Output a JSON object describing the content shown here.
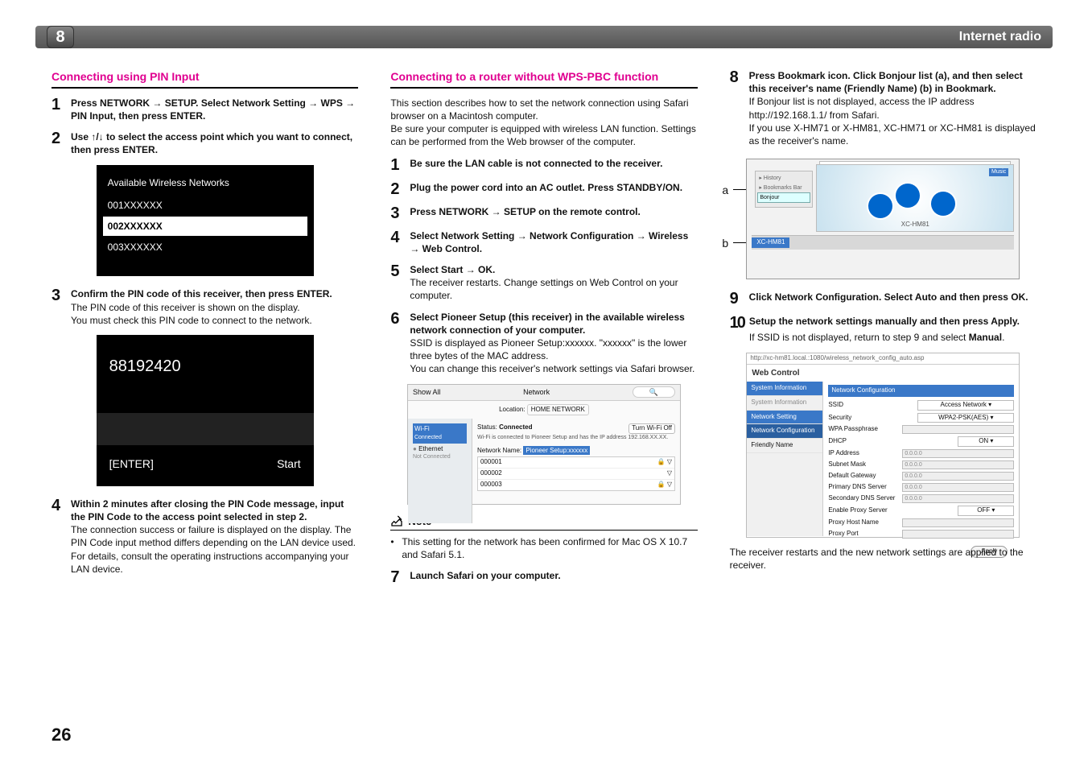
{
  "page": {
    "chapter_badge": "8",
    "section_title": "Internet radio",
    "footer_page": "26"
  },
  "col1": {
    "heading": "Connecting using PIN Input",
    "step1": "Press NETWORK → SETUP. Select Network Setting → WPS → PIN Input, then press ENTER.",
    "step2": "Use ↑/↓ to select the access point which you want to connect, then press ENTER.",
    "wifi_title": "Available Wireless Networks",
    "wifi_items": [
      "001XXXXXX",
      "002XXXXXX",
      "003XXXXXX"
    ],
    "step3_strong": "Confirm the PIN code of this receiver, then press ENTER.",
    "step3_body1": "The PIN code of this receiver is shown on the display.",
    "step3_body2": "You must check this PIN code to connect to the network.",
    "pin_code": "88192420",
    "pin_enter": "[ENTER]",
    "pin_start": "Start",
    "step4_strong": "Within 2 minutes after closing the PIN Code message, input the PIN Code to the access point selected in step 2.",
    "step4_body": "The connection success or failure is displayed on the display. The PIN Code input method differs depending on the LAN device used. For details, consult the operating instructions accompanying your LAN device."
  },
  "col2": {
    "heading": "Connecting to a router without WPS-PBC function",
    "intro": "This section describes how to set the network connection using Safari browser on a Macintosh computer.\nBe sure your computer is equipped with wireless LAN function. Settings can be performed from the Web browser of the computer.",
    "step1": "Be sure the LAN cable is not connected to the receiver.",
    "step2": "Plug the power cord into an AC outlet. Press STANDBY/ON.",
    "step3": "Press NETWORK → SETUP on the remote control.",
    "step4": "Select Network Setting → Network Configuration → Wireless → Web Control.",
    "step5_strong": "Select Start → OK.",
    "step5_body": "The receiver restarts. Change settings on Web Control on your computer.",
    "step6_strong": "Select Pioneer Setup (this receiver) in the available wireless network connection of your computer.",
    "step6_body1": "SSID is displayed as Pioneer Setup:xxxxxx. \"xxxxxx\" is the lower three bytes of the MAC address.",
    "step6_body2": "You can change this receiver's network settings via Safari browser.",
    "safari_fig": {
      "showall": "Show All",
      "network": "Network",
      "location_label": "Location:",
      "location_val": "HOME NETWORK",
      "side_wifi": "Wi-Fi",
      "side_wifi_state": "Connected",
      "side_eth": "Ethernet",
      "side_eth_state": "Not Connected",
      "status_label": "Status:",
      "status_val": "Connected",
      "turn_off": "Turn Wi-Fi Off",
      "status_sub": "Wi-Fi is connected to Pioneer Setup and has the IP address 192.168.XX.XX.",
      "nn_label": "Network Name:",
      "nn_val": "Pioneer Setup:xxxxxx",
      "nets": [
        "000001",
        "000002",
        "000003"
      ]
    },
    "note_label": "Note",
    "note_body": "This setting for the network has been confirmed for Mac OS X 10.7 and Safari 5.1.",
    "step7": "Launch Safari on your computer."
  },
  "col3": {
    "step8_strong": "Press Bookmark icon. Click Bonjour list (a), and then select this receiver's name (Friendly Name) (b) in Bookmark.",
    "step8_body1": "If Bonjour list is not displayed, access the IP address http://192.168.1.1/ from Safari.",
    "step8_body2": "If you use X-HM71 or X-HM81, XC-HM71 or XC-HM81 is displayed as the receiver's name.",
    "bonjour_labels": {
      "a": "a",
      "b": "b",
      "bonjour": "Bonjour",
      "friendly": "XC-HM81"
    },
    "step9_strong": "Click Network Configuration. Select Auto and then press OK.",
    "step10_strong": "Setup the network settings manually and then press Apply.",
    "step10_body": "If SSID is not displayed, return to step 9 and select Manual.",
    "webctrl": {
      "addr": "http://xc-hm81.local.:1080/wireless_network_config_auto.asp",
      "title": "Web Control",
      "side": [
        "System Information",
        "Network Setting",
        "Network Configuration",
        "Friendly Name"
      ],
      "header": "Network Configuration",
      "rows": [
        {
          "lbl": "SSID",
          "val": "Access Network",
          "type": "select"
        },
        {
          "lbl": "Security",
          "val": "WPA2-PSK(AES)",
          "type": "select"
        },
        {
          "lbl": "WPA Passphrase",
          "val": "",
          "type": "text"
        },
        {
          "lbl": "DHCP",
          "val": "ON",
          "type": "select-sm"
        },
        {
          "lbl": "IP Address",
          "val": "0.0.0.0",
          "type": "text"
        },
        {
          "lbl": "Subnet Mask",
          "val": "0.0.0.0",
          "type": "text"
        },
        {
          "lbl": "Default Gateway",
          "val": "0.0.0.0",
          "type": "text"
        },
        {
          "lbl": "Primary DNS Server",
          "val": "0.0.0.0",
          "type": "text"
        },
        {
          "lbl": "Secondary DNS Server",
          "val": "0.0.0.0",
          "type": "text"
        },
        {
          "lbl": "Enable Proxy Server",
          "val": "OFF",
          "type": "select-sm"
        },
        {
          "lbl": "Proxy Host Name",
          "val": "",
          "type": "text"
        },
        {
          "lbl": "Proxy Port",
          "val": "",
          "type": "text"
        }
      ],
      "apply": "Apply"
    },
    "closing": "The receiver restarts and the new network settings are applied to the receiver."
  }
}
